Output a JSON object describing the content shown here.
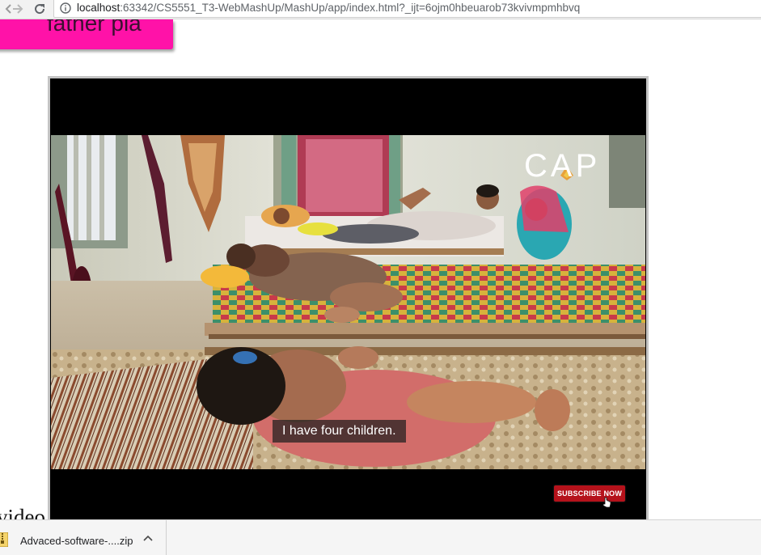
{
  "browser": {
    "url_host": "localhost",
    "url_rest": ":63342/CS5551_T3-WebMashUp/MashUp/app/index.html?_ijt=6ojm0hbeuarob73kvivmpmhbvq"
  },
  "page": {
    "card_text": "father pla",
    "video_label": "video"
  },
  "video": {
    "caption": "I have four children.",
    "logo": "CAP",
    "subscribe_label": "SUBSCRIBE NOW"
  },
  "download_bar": {
    "file_name": "Advaced-software-....zip"
  },
  "colors": {
    "pink": "#ff12a8",
    "subscribe_red": "#b5121b",
    "logo_orange": "#e8a13a"
  }
}
